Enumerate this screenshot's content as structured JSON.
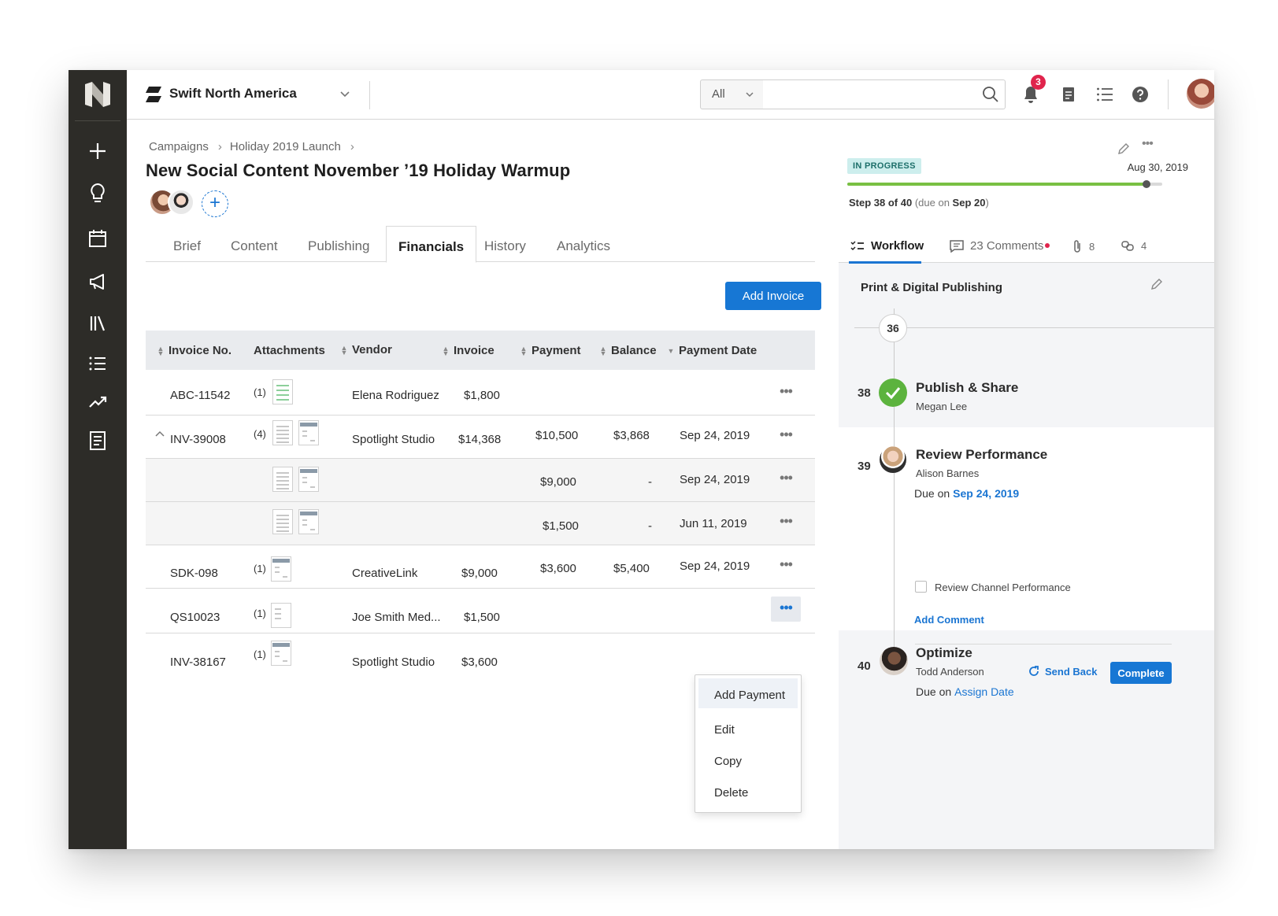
{
  "header": {
    "org_name": "Swift North America",
    "search_scope": "All",
    "search_placeholder": "",
    "notification_count": "3"
  },
  "breadcrumb": [
    "Campaigns",
    "Holiday 2019 Launch"
  ],
  "page_title": "New Social Content November ’19 Holiday Warmup",
  "tabs": [
    "Brief",
    "Content",
    "Publishing",
    "Financials",
    "History",
    "Analytics"
  ],
  "active_tab": "Financials",
  "add_invoice_label": "Add Invoice",
  "table": {
    "columns": [
      "Invoice No.",
      "Attachments",
      "Vendor",
      "Invoice",
      "Payment",
      "Balance",
      "Payment Date"
    ],
    "rows": [
      {
        "invoice_no": "ABC-11542",
        "attachments": "(1)",
        "vendor": "Elena Rodriguez",
        "invoice": "$1,800",
        "payment": "",
        "balance": "",
        "payment_date": ""
      },
      {
        "invoice_no": "INV-39008",
        "attachments": "(4)",
        "vendor": "Spotlight Studio",
        "invoice": "$14,368",
        "payment": "$10,500",
        "balance": "$3,868",
        "payment_date": "Sep 24, 2019"
      },
      {
        "invoice_no": "",
        "attachments": "",
        "vendor": "",
        "invoice": "",
        "payment": "$9,000",
        "balance": "-",
        "payment_date": "Sep 24, 2019"
      },
      {
        "invoice_no": "",
        "attachments": "",
        "vendor": "",
        "invoice": "",
        "payment": "$1,500",
        "balance": "-",
        "payment_date": "Jun 11, 2019"
      },
      {
        "invoice_no": "SDK-098",
        "attachments": "(1)",
        "vendor": "CreativeLink",
        "invoice": "$9,000",
        "payment": "$3,600",
        "balance": "$5,400",
        "payment_date": "Sep 24, 2019"
      },
      {
        "invoice_no": "QS10023",
        "attachments": "(1)",
        "vendor": "Joe Smith Med...",
        "invoice": "$1,500",
        "payment": "",
        "balance": "",
        "payment_date": ""
      },
      {
        "invoice_no": "INV-38167",
        "attachments": "(1)",
        "vendor": "Spotlight Studio",
        "invoice": "$3,600",
        "payment": "",
        "balance": "",
        "payment_date": ""
      }
    ]
  },
  "row_menu": [
    "Add Payment",
    "Edit",
    "Copy",
    "Delete"
  ],
  "right_panel": {
    "status": "IN PROGRESS",
    "end_date": "Aug 30, 2019",
    "progress": 0.95,
    "step_text": "Step 38 of 40",
    "due_prefix": "(due on",
    "due_date": "Sep 20",
    "due_suffix": ")",
    "tabs": {
      "workflow": "Workflow",
      "comments": "23 Comments",
      "attachments": "8",
      "links": "4"
    },
    "phase_title": "Print & Digital Publishing",
    "steps": [
      {
        "num": "36"
      },
      {
        "num": "38",
        "title": "Publish & Share",
        "owner": "Megan Lee"
      },
      {
        "num": "39",
        "title": "Review Performance",
        "owner": "Alison Barnes",
        "due_label": "Due on",
        "due": "Sep 24, 2019",
        "task": "Review Channel Performance",
        "add_comment": "Add Comment",
        "send_back": "Send Back",
        "complete": "Complete"
      },
      {
        "num": "40",
        "title": "Optimize",
        "owner": "Todd Anderson",
        "due_label": "Due on",
        "due": "Assign Date"
      }
    ]
  },
  "colors": {
    "rail": "#2d2c28",
    "accent": "#1777d4",
    "success": "#5cb33e",
    "badge": "#e0244c",
    "status_bg": "#cdeeed"
  }
}
